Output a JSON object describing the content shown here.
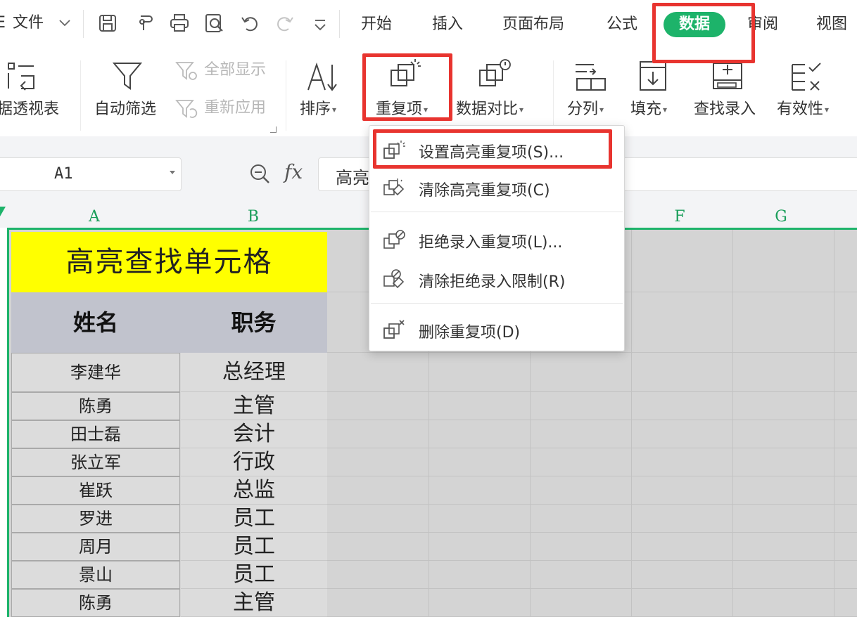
{
  "menubar": {
    "file_label": "文件",
    "tabs": [
      "开始",
      "插入",
      "页面布局",
      "公式",
      "数据",
      "审阅",
      "视图"
    ],
    "active_tab": "数据"
  },
  "ribbon": {
    "pivot_label": "据透视表",
    "autofilter_label": "自动筛选",
    "show_all_label": "全部显示",
    "reapply_label": "重新应用",
    "sort_label": "排序",
    "duplicates_label": "重复项",
    "compare_label": "数据对比",
    "split_label": "分列",
    "fill_label": "填充",
    "lookup_label": "查找录入",
    "validity_label": "有效性"
  },
  "formula_bar": {
    "name_box": "A1",
    "fx": "fx",
    "formula": "高亮"
  },
  "columns": [
    "A",
    "B",
    "F",
    "G"
  ],
  "sheet": {
    "title": "高亮查找单元格",
    "headers": [
      "姓名",
      "职务"
    ],
    "rows": [
      {
        "name": "李建华",
        "role": "总经理"
      },
      {
        "name": "陈勇",
        "role": "主管"
      },
      {
        "name": "田士磊",
        "role": "会计"
      },
      {
        "name": "张立军",
        "role": "行政"
      },
      {
        "name": "崔跃",
        "role": "总监"
      },
      {
        "name": "罗进",
        "role": "员工"
      },
      {
        "name": "周月",
        "role": "员工"
      },
      {
        "name": "景山",
        "role": "员工"
      },
      {
        "name": "陈勇",
        "role": "主管"
      }
    ]
  },
  "dropdown": {
    "items": [
      "设置高亮重复项(S)...",
      "清除高亮重复项(C)",
      "拒绝录入重复项(L)...",
      "清除拒绝录入限制(R)",
      "删除重复项(D)"
    ]
  },
  "colors": {
    "accent": "#1db36a",
    "highlight_box": "#e8342f",
    "title_fill": "#ffff00",
    "header_fill": "#c1c3cd"
  }
}
